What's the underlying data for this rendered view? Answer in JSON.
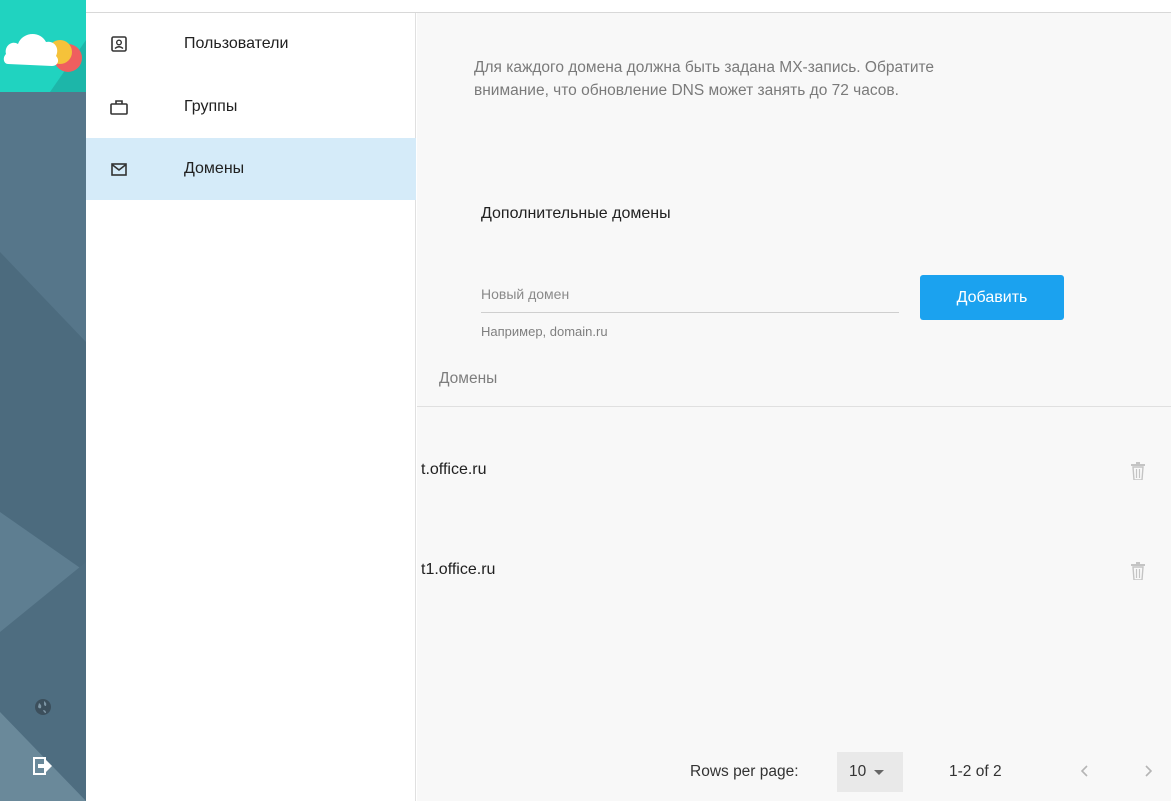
{
  "rail": {
    "logo_icon": "cloud-logo",
    "language_icon": "globe-icon",
    "logout_icon": "logout-icon"
  },
  "nav": {
    "items": [
      {
        "label": "Пользователи",
        "icon": "user-card-icon",
        "active": false
      },
      {
        "label": "Группы",
        "icon": "briefcase-icon",
        "active": false
      },
      {
        "label": "Домены",
        "icon": "envelope-icon",
        "active": true
      }
    ]
  },
  "main": {
    "info_text": "Для каждого домена должна быть задана MX-запись. Обратите внимание, что обновление DNS может занять до 72 часов.",
    "subhead": "Дополнительные домены",
    "new_domain": {
      "placeholder": "Новый домен",
      "value": "",
      "hint": "Например, domain.ru"
    },
    "add_button": "Добавить",
    "column_header": "Домены",
    "domains": [
      {
        "name": "t.office.ru"
      },
      {
        "name": "t1.office.ru"
      }
    ],
    "pagination": {
      "rows_per_page_label": "Rows per page:",
      "rows_per_page_value": "10",
      "range": "1-2 of 2"
    }
  },
  "colors": {
    "accent": "#1ba2ef",
    "active_nav": "#d5ebf9",
    "rail": "#4f6e80",
    "logo_bg": "#20d3c0"
  }
}
